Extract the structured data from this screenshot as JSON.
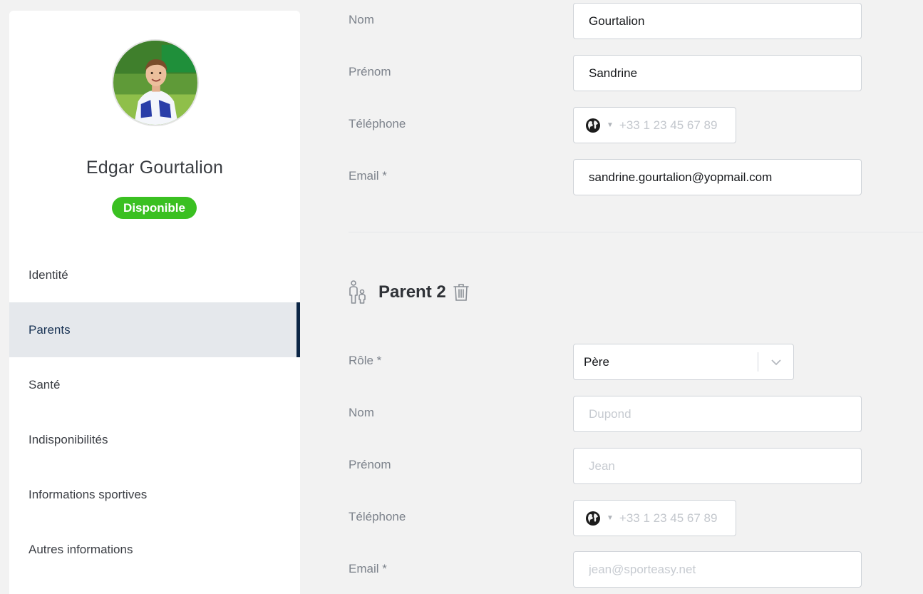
{
  "player": {
    "name": "Edgar Gourtalion",
    "status": "Disponible"
  },
  "sidebar": {
    "items": [
      {
        "label": "Identité"
      },
      {
        "label": "Parents"
      },
      {
        "label": "Santé"
      },
      {
        "label": "Indisponibilités"
      },
      {
        "label": "Informations sportives"
      },
      {
        "label": "Autres informations"
      }
    ],
    "active_item": "Parents"
  },
  "parent1": {
    "nom_label": "Nom",
    "nom_value": "Gourtalion",
    "prenom_label": "Prénom",
    "prenom_value": "Sandrine",
    "telephone_label": "Téléphone",
    "telephone_placeholder": "+33 1 23 45 67 89",
    "email_label": "Email *",
    "email_value": "sandrine.gourtalion@yopmail.com"
  },
  "parent2": {
    "title": "Parent 2",
    "role_label": "Rôle *",
    "role_value": "Père",
    "nom_label": "Nom",
    "nom_placeholder": "Dupond",
    "prenom_label": "Prénom",
    "prenom_placeholder": "Jean",
    "telephone_label": "Téléphone",
    "telephone_placeholder": "+33 1 23 45 67 89",
    "email_label": "Email *",
    "email_placeholder": "jean@sporteasy.net"
  },
  "icons": {
    "globe": "globe-icon",
    "caret": "caret-down-icon",
    "parent": "parent-child-icon",
    "trash": "trash-icon",
    "chevron": "chevron-down-icon"
  },
  "colors": {
    "status_green": "#3ac021",
    "active_nav_bg": "#e5e8ec",
    "active_nav_bar": "#0b2545"
  }
}
